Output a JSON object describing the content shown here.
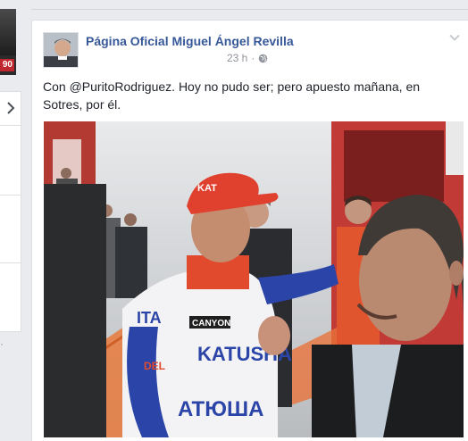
{
  "left": {
    "badge_number": "90"
  },
  "post": {
    "page_name": "Página Oficial Miguel Ángel Revilla",
    "time": "23 h",
    "separator": "·",
    "text": "Con @PuritoRodriguez. Hoy no pudo ser; pero apuesto mañana, en Sotres, por él.",
    "icons": {
      "audience": "globe-icon",
      "options": "chevron-down-icon"
    },
    "photo_jersey_texts": [
      "KAT",
      "ITA",
      "KATUSHA",
      "CANYON",
      "DEL",
      "ATЮША"
    ]
  }
}
